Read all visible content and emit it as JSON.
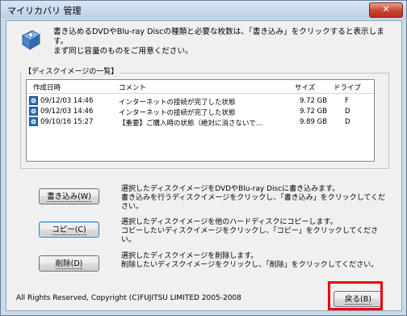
{
  "window": {
    "title": "マイリカバリ 管理",
    "close_glyph": "✕"
  },
  "intro": "書き込めるDVDやBlu-ray Discの種類と必要な枚数は、「書き込み」をクリックすると表示します。\nまず同じ容量のものをご用意ください。",
  "list": {
    "label": "【ディスクイメージの一覧】",
    "columns": [
      "作成日時",
      "コメント",
      "サイズ",
      "ドライブ"
    ],
    "rows": [
      {
        "date": "09/12/03 14:46",
        "comment": "インターネットの接続が完了した状態",
        "size": "9.72 GB",
        "drive": "F"
      },
      {
        "date": "09/12/03 14:46",
        "comment": "インターネットの接続が完了した状態",
        "size": "9.72 GB",
        "drive": "D"
      },
      {
        "date": "09/10/16 15:27",
        "comment": "【重要】ご購入時の状態（絶対に消さないで…",
        "size": "9.89 GB",
        "drive": "D"
      }
    ]
  },
  "actions": {
    "write": {
      "label": "書き込み(W)",
      "desc": "選択したディスクイメージをDVDやBlu-ray Discに書き込みます。\n書き込みを行うディスクイメージをクリックし、「書き込み」をクリックしてください。"
    },
    "copy": {
      "label": "コピー(C)",
      "desc": "選択したディスクイメージを他のハードディスクにコピーします。\nコピーしたいディスクイメージをクリックし、「コピー」をクリックしてください。"
    },
    "delete": {
      "label": "削除(D)",
      "desc": "選択したディスクイメージを削除します。\n削除したいディスクイメージをクリックし、「削除」をクリックしてください。"
    }
  },
  "footer": {
    "copyright": "All Rights Reserved, Copyright (C)FUJITSU LIMITED 2005-2008",
    "back_label": "戻る(B)"
  },
  "colors": {
    "highlight": "#e60012",
    "accent": "#3c7fb1"
  },
  "icons": {
    "app": "disc-tools-icon",
    "row": "disc-image-icon"
  }
}
